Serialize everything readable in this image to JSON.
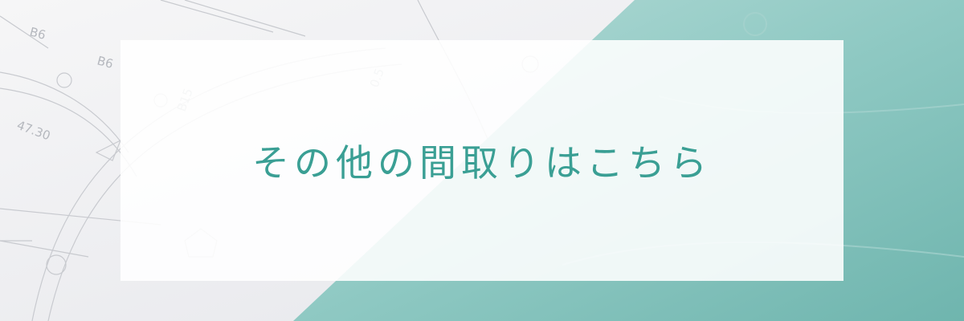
{
  "banner": {
    "title": "その他の間取りはこちら",
    "accent_color": "#3a9f94",
    "teal_color": "#8cc8c2",
    "blueprint_labels": [
      "B6",
      "B6",
      "B15",
      "47.30",
      "0.5"
    ]
  }
}
